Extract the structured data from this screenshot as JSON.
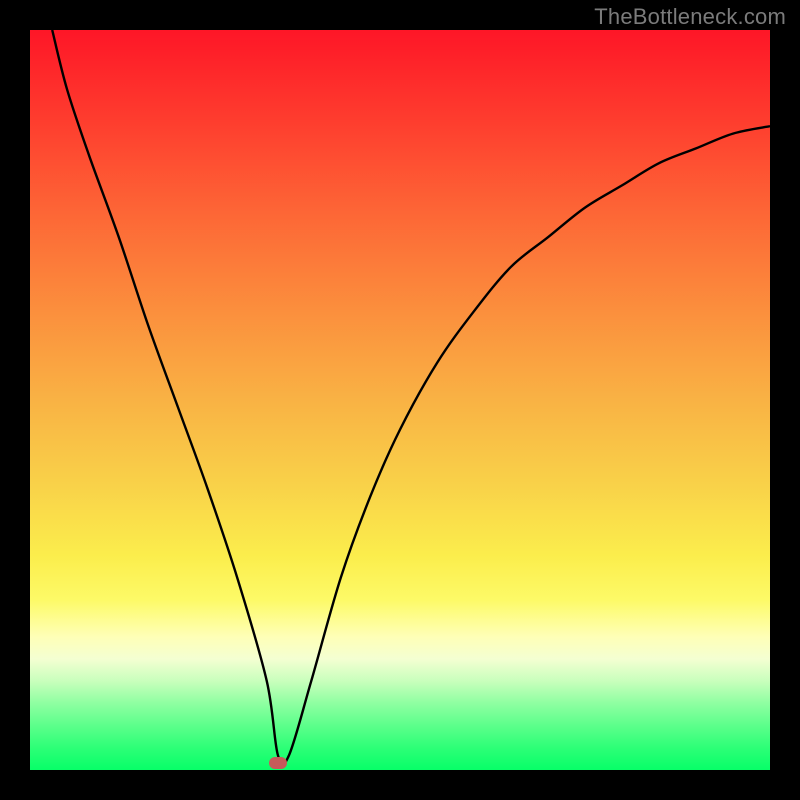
{
  "watermark": "TheBottleneck.com",
  "chart_data": {
    "type": "line",
    "title": "",
    "xlabel": "",
    "ylabel": "",
    "xlim": [
      0,
      100
    ],
    "ylim": [
      0,
      100
    ],
    "grid": false,
    "legend": false,
    "series": [
      {
        "name": "curve",
        "x": [
          3,
          5,
          8,
          12,
          16,
          20,
          24,
          28,
          32,
          33.5,
          35,
          38,
          42,
          46,
          50,
          55,
          60,
          65,
          70,
          75,
          80,
          85,
          90,
          95,
          100
        ],
        "y": [
          100,
          92,
          83,
          72,
          60,
          49,
          38,
          26,
          12,
          2,
          2,
          12,
          26,
          37,
          46,
          55,
          62,
          68,
          72,
          76,
          79,
          82,
          84,
          86,
          87
        ]
      }
    ],
    "marker": {
      "x": 33.5,
      "y": 1
    },
    "background_gradient": {
      "top": "#fe1627",
      "bottom": "#07ff68"
    }
  }
}
